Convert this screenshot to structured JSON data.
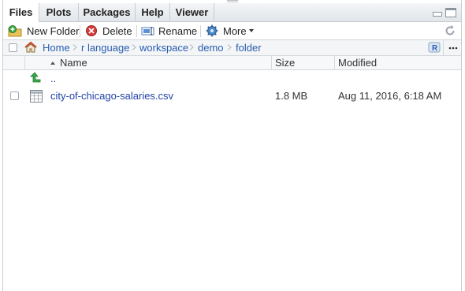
{
  "tabs": [
    {
      "label": "Files",
      "active": true
    },
    {
      "label": "Plots",
      "active": false
    },
    {
      "label": "Packages",
      "active": false
    },
    {
      "label": "Help",
      "active": false
    },
    {
      "label": "Viewer",
      "active": false
    }
  ],
  "toolbar": {
    "new_folder": "New Folder",
    "delete": "Delete",
    "rename": "Rename",
    "more": "More"
  },
  "breadcrumb": [
    "Home",
    "r language",
    "workspace",
    "demo",
    "folder"
  ],
  "columns": {
    "name": "Name",
    "size": "Size",
    "modified": "Modified"
  },
  "parent": {
    "label": ".."
  },
  "files": [
    {
      "name": "city-of-chicago-salaries.csv",
      "size": "1.8 MB",
      "modified": "Aug 11, 2016, 6:18 AM"
    }
  ],
  "colors": {
    "link": "#2143a8",
    "accent": "#2a5db0"
  }
}
